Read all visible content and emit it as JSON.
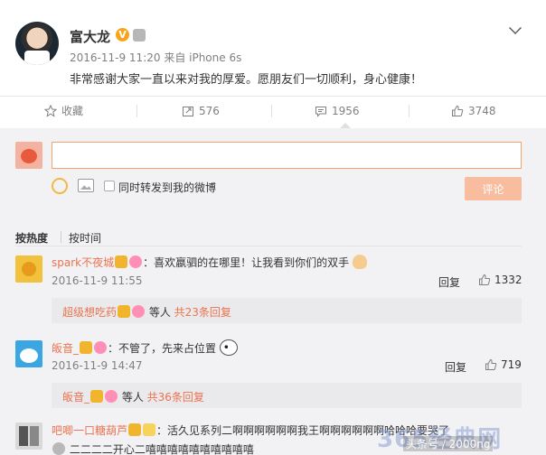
{
  "post": {
    "author": "富大龙",
    "vip_badge": "V",
    "meta": "2016-11-9 11:20 来自 iPhone 6s",
    "text": "非常感谢大家一直以来对我的厚爱。愿朋友们一切顺利，身心健康！"
  },
  "actions": {
    "favorite": "收藏",
    "repost": "576",
    "comments": "1956",
    "likes": "3748"
  },
  "composer": {
    "input_value": "",
    "forward_label": "同时转发到我的微博",
    "submit_label": "评论"
  },
  "sort": {
    "hot": "按热度",
    "time": "按时间"
  },
  "comments": [
    {
      "name": "spark不夜城",
      "text": "：喜欢嬴驷的在哪里！让我看到你们的双手",
      "time": "2016-11-9 11:55",
      "reply": "回复",
      "likes": "1332",
      "sub": {
        "name": "超级想吃药",
        "mid": " 等人 ",
        "count": "共23条回复"
      }
    },
    {
      "name": "皈音_",
      "text": "：不管了，先来占位置",
      "time": "2016-11-9 14:47",
      "reply": "回复",
      "likes": "719",
      "sub": {
        "name": "皈音_",
        "mid": " 等人 ",
        "count": "共36条回复"
      }
    },
    {
      "name": "吧唧一口糖葫芦",
      "text": "：活久见系列二啊啊啊啊啊啊我王啊啊啊啊啊啊哈哈哈要哭了",
      "line2": "二二二二开心二嘻嘻嘻嘻嘻嘻嘻嘻嘻嘻"
    }
  ],
  "watermark": {
    "main": "365经典网",
    "sub": "头条号 / 2000ng"
  },
  "colors": {
    "accent": "#eb7350",
    "input_border": "#f3a26a",
    "submit_bg": "#f8bd9f",
    "panel_bg": "#f2f2f5"
  }
}
